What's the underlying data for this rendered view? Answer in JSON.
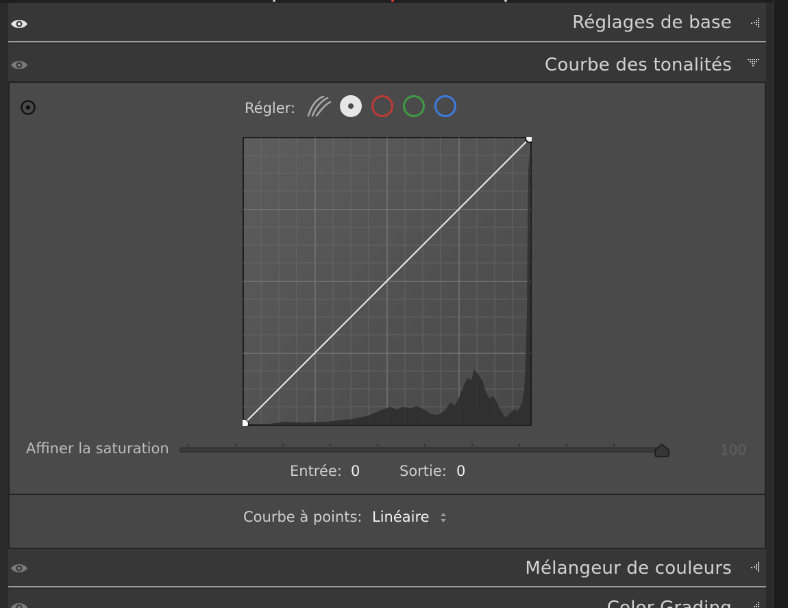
{
  "sections": {
    "basic": {
      "title": "Réglages de base"
    },
    "tone_curve": {
      "title": "Courbe des tonalités"
    },
    "color_mixer": {
      "title": "Mélangeur de couleurs"
    },
    "color_grading": {
      "title": "Color Grading"
    }
  },
  "tone_curve": {
    "adjust_label": "Régler:",
    "channels": [
      "parametric",
      "point-white",
      "red",
      "green",
      "blue"
    ],
    "selected_channel": "point-white",
    "channel_colors": {
      "red": "#c03a36",
      "green": "#3f9a45",
      "blue": "#3c7be0"
    },
    "refine_saturation": {
      "label": "Affiner la saturation",
      "value": "100"
    },
    "input": {
      "label": "Entrée:",
      "value": "0"
    },
    "output": {
      "label": "Sortie:",
      "value": "0"
    },
    "point_curve": {
      "label": "Courbe à points:",
      "value": "Linéaire"
    }
  }
}
